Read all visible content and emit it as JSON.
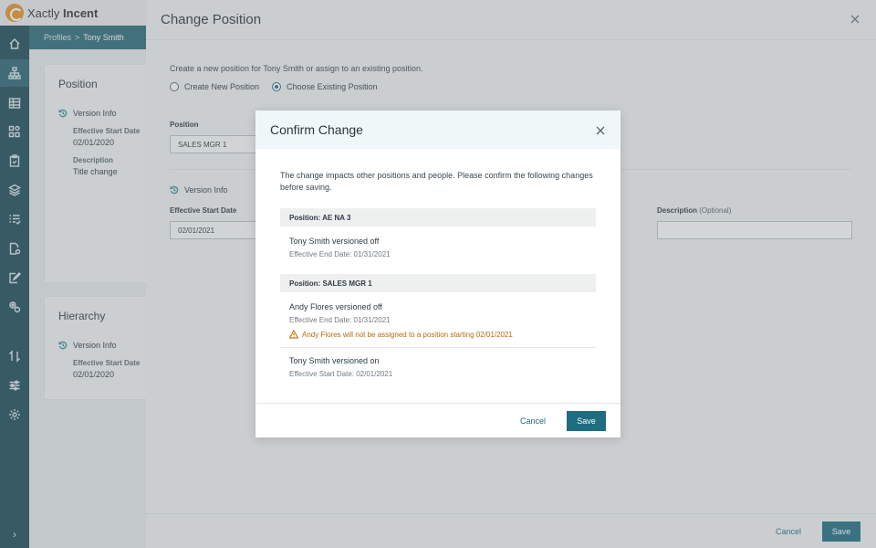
{
  "app": {
    "logo_left": "Xactly",
    "logo_right": "Incent"
  },
  "breadcrumb": {
    "root": "Profiles",
    "sep": ">",
    "current": "Tony Smith"
  },
  "sidebar": {
    "icons": [
      "home-icon",
      "org-chart-icon",
      "table-icon",
      "shapes-icon",
      "clipboard-icon",
      "layers-icon",
      "checklist-icon",
      "doc-settings-icon",
      "edit-icon",
      "gears-icon",
      "transfer-icon",
      "sliders-icon",
      "settings-icon"
    ],
    "active_index": 1,
    "expand_label": "›"
  },
  "profile": {
    "position_card": {
      "title": "Position",
      "version_info": "Version Info",
      "start_label": "Effective Start Date",
      "start_value": "02/01/2020",
      "desc_label": "Description",
      "desc_value": "Title change"
    },
    "hierarchy_card": {
      "title": "Hierarchy",
      "version_info": "Version Info",
      "start_label": "Effective Start Date",
      "start_value": "02/01/2020"
    }
  },
  "panel": {
    "title": "Change Position",
    "intro": "Create a new position for Tony Smith or assign to an existing position.",
    "radio_new": "Create New Position",
    "radio_existing": "Choose Existing Position",
    "selected": "existing",
    "position_label": "Position",
    "position_value": "SALES MGR 1",
    "version_info": "Version Info",
    "start_label": "Effective Start Date",
    "start_value": "02/01/2021",
    "desc_label": "Description",
    "desc_optional": "(Optional)",
    "desc_value": "",
    "cancel": "Cancel",
    "save": "Save"
  },
  "modal": {
    "title": "Confirm Change",
    "description": "The change impacts other positions and people. Please confirm the following changes before saving.",
    "groups": [
      {
        "header": "Position: AE NA 3",
        "entries": [
          {
            "title": "Tony Smith versioned off",
            "sub": "Effective End Date: 01/31/2021"
          }
        ]
      },
      {
        "header": "Position: SALES MGR 1",
        "entries": [
          {
            "title": "Andy Flores versioned off",
            "sub": "Effective End Date: 01/31/2021",
            "warning": "Andy Flores will not be assigned to a position starting 02/01/2021"
          },
          {
            "title": "Tony Smith versioned on",
            "sub": "Effective Start Date: 02/01/2021"
          }
        ]
      }
    ],
    "cancel": "Cancel",
    "save": "Save"
  },
  "colors": {
    "accent": "#1f6d80",
    "sidebar": "#1d4a56",
    "warning": "#c97a1a"
  }
}
